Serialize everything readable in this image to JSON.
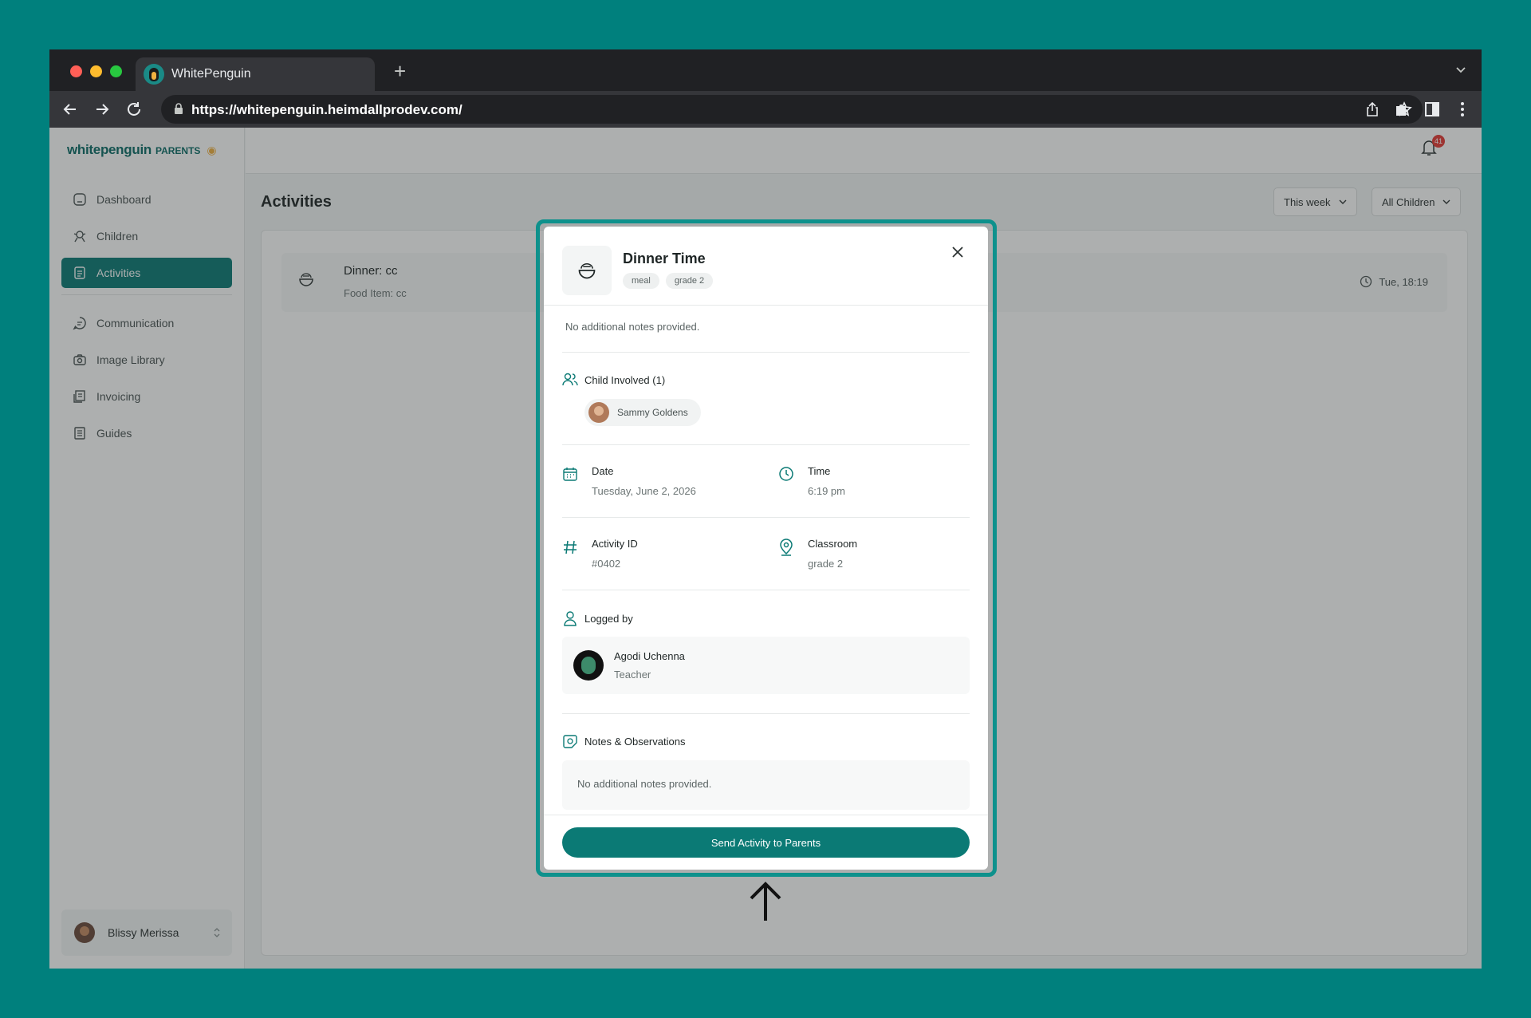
{
  "browser": {
    "tab_title": "WhitePenguin",
    "url": "https://whitepenguin.heimdallprodev.com/"
  },
  "sidebar": {
    "logo_main": "whitepenguin",
    "logo_sub": "PARENTS",
    "items": [
      {
        "label": "Dashboard",
        "icon": "dashboard-icon"
      },
      {
        "label": "Children",
        "icon": "children-icon"
      },
      {
        "label": "Activities",
        "icon": "activities-icon",
        "active": true
      },
      {
        "label": "Communication",
        "icon": "chat-icon"
      },
      {
        "label": "Image Library",
        "icon": "camera-icon"
      },
      {
        "label": "Invoicing",
        "icon": "invoice-icon"
      },
      {
        "label": "Guides",
        "icon": "guide-icon"
      }
    ],
    "user_name": "Blissy Merissa"
  },
  "topbar": {
    "notification_count": "41"
  },
  "page": {
    "title": "Activities",
    "filter_period": "This week",
    "filter_children": "All Children"
  },
  "activity_list": [
    {
      "title": "Dinner: cc",
      "subtitle": "Food Item: cc",
      "time": "Tue, 18:19"
    }
  ],
  "modal": {
    "title": "Dinner Time",
    "tags": [
      "meal",
      "grade 2"
    ],
    "top_note": "No additional notes provided.",
    "child_section_label": "Child Involved (1)",
    "child_name": "Sammy Goldens",
    "date_label": "Date",
    "date_value": "Tuesday, June 2, 2026",
    "time_label": "Time",
    "time_value": "6:19 pm",
    "id_label": "Activity ID",
    "id_value": "#0402",
    "classroom_label": "Classroom",
    "classroom_value": "grade 2",
    "logged_by_label": "Logged by",
    "logger_name": "Agodi Uchenna",
    "logger_role": "Teacher",
    "notes_label": "Notes & Observations",
    "notes_value": "No additional notes provided.",
    "send_button": "Send Activity to Parents"
  },
  "colors": {
    "background": "#00807d",
    "accent": "#0b7a75",
    "highlight_ring": "#0e918c"
  }
}
